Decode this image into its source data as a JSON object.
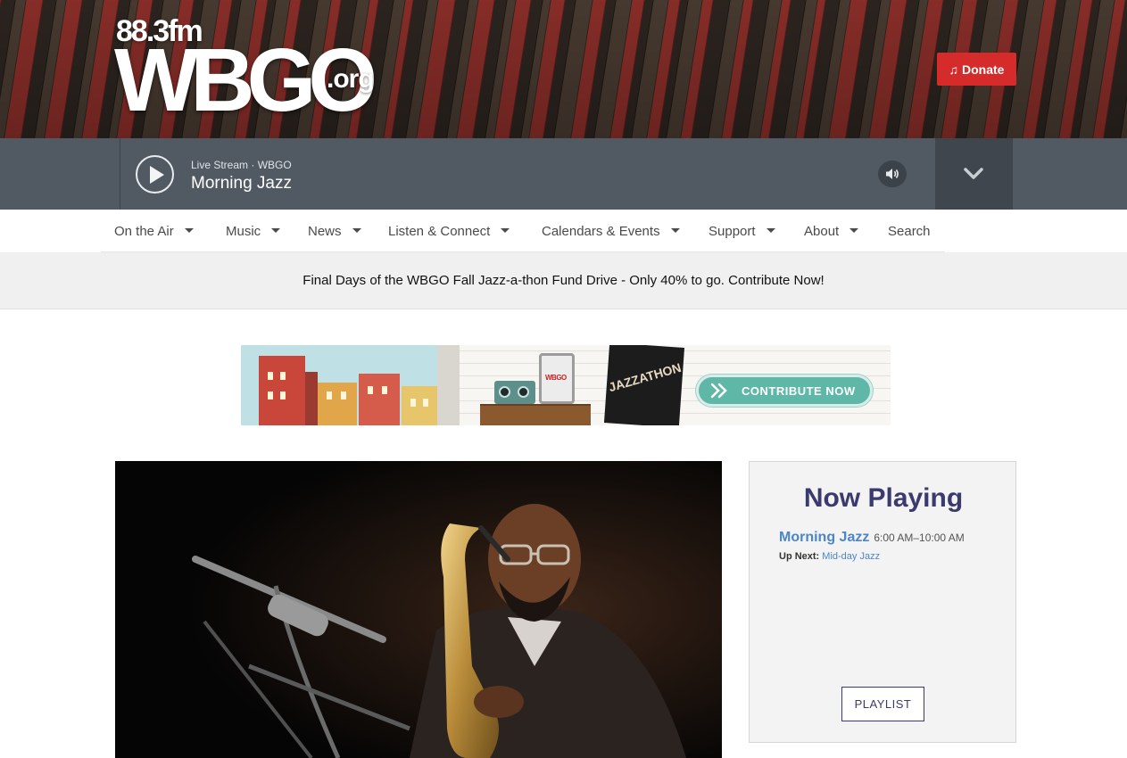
{
  "header": {
    "logo": {
      "frequency": "88.3fm",
      "callsign": "WBGO",
      "domain": ".org"
    },
    "donate_label": "Donate",
    "donate_icon": "music-note-icon"
  },
  "player": {
    "stream_label": "Live Stream · WBGO",
    "show_title": "Morning Jazz",
    "play_icon": "play-icon",
    "volume_icon": "volume-icon",
    "expand_icon": "chevron-down-icon"
  },
  "nav": {
    "items": [
      {
        "label": "On the Air",
        "has_dropdown": true
      },
      {
        "label": "Music",
        "has_dropdown": true
      },
      {
        "label": "News",
        "has_dropdown": true
      },
      {
        "label": "Listen & Connect",
        "has_dropdown": true
      },
      {
        "label": "Calendars & Events",
        "has_dropdown": true
      },
      {
        "label": "Support",
        "has_dropdown": true
      },
      {
        "label": "About",
        "has_dropdown": true
      },
      {
        "label": "Search",
        "has_dropdown": false
      }
    ]
  },
  "fund_drive": {
    "message": "Final Days of the WBGO Fall Jazz-a-thon Fund Drive - Only 40% to go. Contribute Now!"
  },
  "ad": {
    "cta_label": "CONTRIBUTE NOW",
    "ticket_text": "JAZZATHON",
    "tablet_text": "WBGO"
  },
  "now_playing": {
    "heading": "Now Playing",
    "show_name": "Morning Jazz",
    "show_time": "6:00 AM–10:00 AM",
    "up_next_label": "Up Next:",
    "up_next_show": "Mid-day Jazz",
    "playlist_label": "PLAYLIST"
  },
  "colors": {
    "donate_red": "#d52b2b",
    "player_bg": "#515a63",
    "now_playing_title": "#3b3a6e",
    "link_blue": "#4a86c8",
    "cta_teal": "#5fb7a8"
  }
}
